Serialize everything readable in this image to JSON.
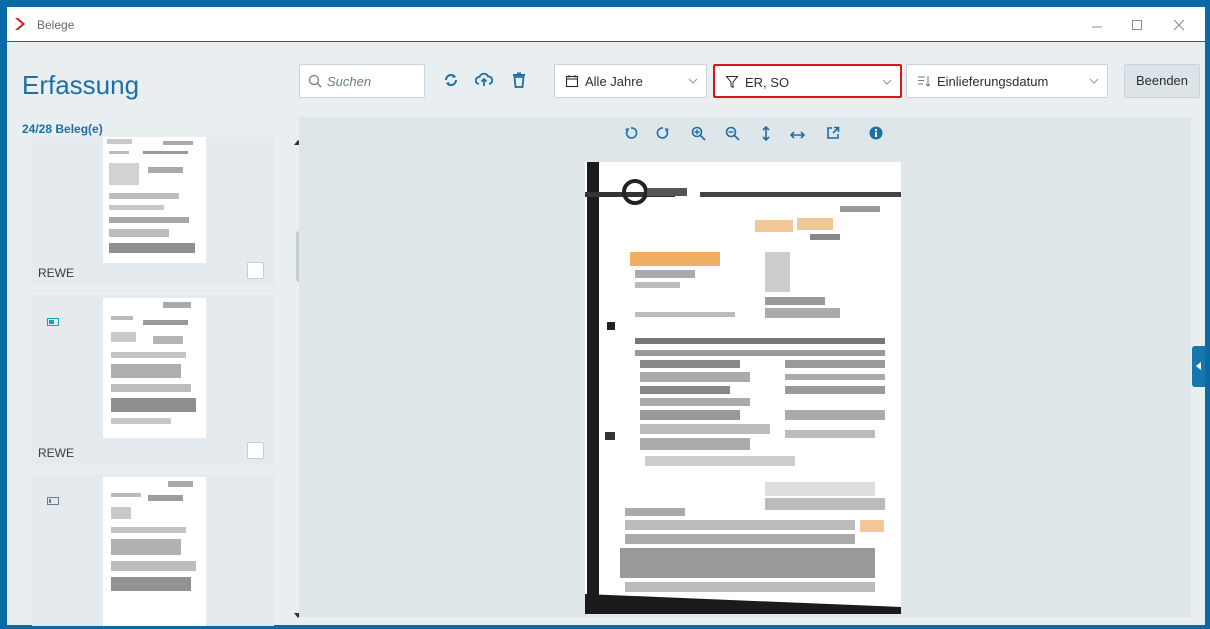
{
  "window": {
    "title": "Belege"
  },
  "app": {
    "title": "Erfassung",
    "count_label": "24/28 Beleg(e)"
  },
  "toolbar": {
    "search_placeholder": "Suchen",
    "years_label": "Alle Jahre",
    "filter_label": "ER, SO",
    "sort_label": "Einlieferungsdatum",
    "close_label": "Beenden"
  },
  "documents": [
    {
      "vendor": "REWE",
      "checked": false
    },
    {
      "vendor": "REWE",
      "checked": false
    },
    {
      "vendor": "",
      "checked": false
    }
  ],
  "colors": {
    "accent": "#1d6fa6",
    "frame": "#0a6aa8",
    "filter_highlight": "#d6171b",
    "logo": "#d6171b"
  }
}
